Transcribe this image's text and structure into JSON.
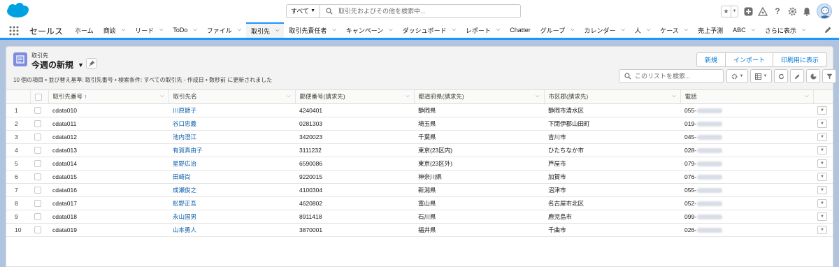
{
  "header": {
    "search_scope": "すべて",
    "search_placeholder": "取引先およびその他を検索中..."
  },
  "nav": {
    "app_name": "セールス",
    "items": [
      {
        "label": "ホーム",
        "chevron": false
      },
      {
        "label": "商談",
        "chevron": true
      },
      {
        "label": "リード",
        "chevron": true
      },
      {
        "label": "ToDo",
        "chevron": true
      },
      {
        "label": "ファイル",
        "chevron": true
      },
      {
        "label": "取引先",
        "chevron": true,
        "active": true
      },
      {
        "label": "取引先責任者",
        "chevron": true
      },
      {
        "label": "キャンペーン",
        "chevron": true
      },
      {
        "label": "ダッシュボード",
        "chevron": true
      },
      {
        "label": "レポート",
        "chevron": true
      },
      {
        "label": "Chatter",
        "chevron": false
      },
      {
        "label": "グループ",
        "chevron": true
      },
      {
        "label": "カレンダー",
        "chevron": true
      },
      {
        "label": "人",
        "chevron": true
      },
      {
        "label": "ケース",
        "chevron": true
      },
      {
        "label": "売上予測",
        "chevron": false
      },
      {
        "label": "ABC",
        "chevron": true
      },
      {
        "label": "さらに表示",
        "chevron": true
      }
    ]
  },
  "list": {
    "object_label": "取引先",
    "view_title": "今週の新規",
    "info": "10 個の項目 • 並び替え基準: 取引先番号 • 検索条件: すべての取引先 - 作成日 • 数秒前 に更新されました",
    "buttons": [
      "新規",
      "インポート",
      "印刷用に表示"
    ],
    "search_placeholder": "このリストを検索...",
    "columns": [
      "取引先番号",
      "取引先名",
      "郵便番号(請求先)",
      "都道府県(請求先)",
      "市区郡(請求先)",
      "電話"
    ],
    "sort_indicator": "↑",
    "rows": [
      {
        "n": "1",
        "id": "cdata010",
        "name": "川原節子",
        "zip": "4240401",
        "pref": "静岡県",
        "city": "静岡市清水区",
        "phone": "055-"
      },
      {
        "n": "2",
        "id": "cdata011",
        "name": "谷口忠義",
        "zip": "0281303",
        "pref": "埼玉県",
        "city": "下閉伊郡山田町",
        "phone": "019-"
      },
      {
        "n": "3",
        "id": "cdata012",
        "name": "池内澄江",
        "zip": "3420023",
        "pref": "千葉県",
        "city": "吉川市",
        "phone": "045-"
      },
      {
        "n": "4",
        "id": "cdata013",
        "name": "有賀真由子",
        "zip": "3111232",
        "pref": "東京(23区内)",
        "city": "ひたちなか市",
        "phone": "028-"
      },
      {
        "n": "5",
        "id": "cdata014",
        "name": "星野広治",
        "zip": "6590086",
        "pref": "東京(23区外)",
        "city": "芦屋市",
        "phone": "079-"
      },
      {
        "n": "6",
        "id": "cdata015",
        "name": "田崎尚",
        "zip": "9220015",
        "pref": "神奈川県",
        "city": "加賀市",
        "phone": "076-"
      },
      {
        "n": "7",
        "id": "cdata016",
        "name": "成瀬俊之",
        "zip": "4100304",
        "pref": "新潟県",
        "city": "沼津市",
        "phone": "055-"
      },
      {
        "n": "8",
        "id": "cdata017",
        "name": "松野正吾",
        "zip": "4620802",
        "pref": "富山県",
        "city": "名古屋市北区",
        "phone": "052-"
      },
      {
        "n": "9",
        "id": "cdata018",
        "name": "永山国男",
        "zip": "8911418",
        "pref": "石川県",
        "city": "鹿児島市",
        "phone": "099-"
      },
      {
        "n": "10",
        "id": "cdata019",
        "name": "山本勇人",
        "zip": "3870001",
        "pref": "福井県",
        "city": "千曲市",
        "phone": "026-"
      }
    ]
  },
  "colors": {
    "brand": "#1b96ff",
    "link": "#0b5cab",
    "account_icon": "#7f8de1"
  }
}
